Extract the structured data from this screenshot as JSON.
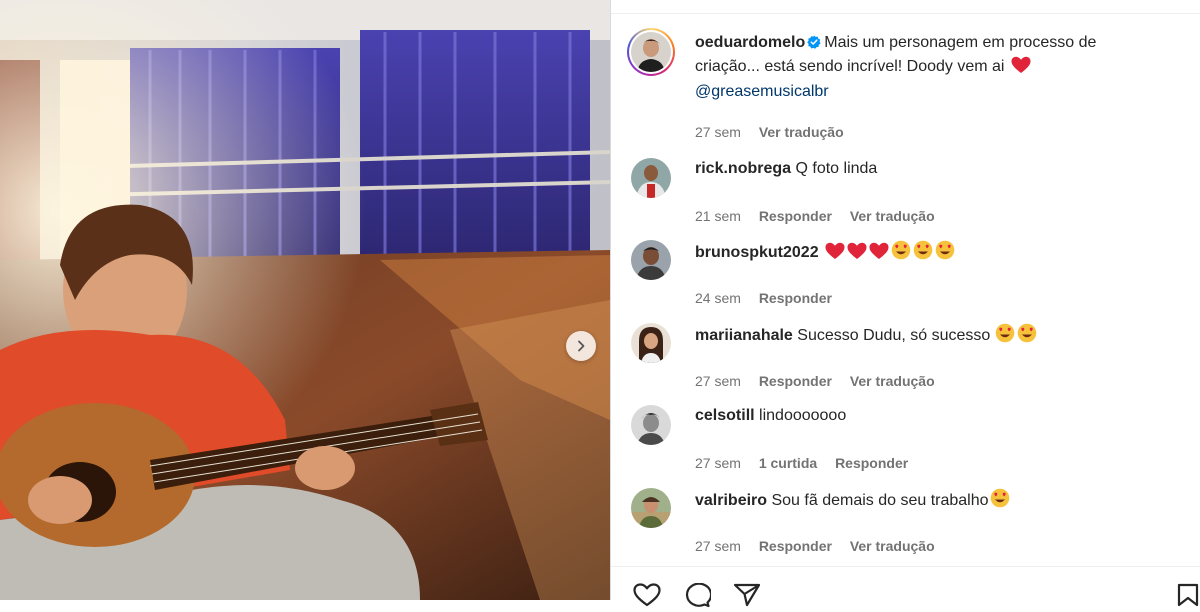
{
  "post": {
    "author": "oeduardomelo",
    "caption_line1": "Mais um personagem em processo de",
    "caption_line2": "criação... está sendo incrível! Doody vem ai",
    "mention": "@greasemusicalbr",
    "time": "27 sem",
    "translate": "Ver tradução",
    "verified": true,
    "caption_emoji": "red-heart"
  },
  "comments": [
    {
      "user": "rick.nobrega",
      "text": "Q foto linda",
      "time": "21 sem",
      "likes": "",
      "reply": "Responder",
      "translate": "Ver tradução",
      "emojis": []
    },
    {
      "user": "brunospkut2022",
      "text": "",
      "time": "24 sem",
      "likes": "",
      "reply": "Responder",
      "translate": "",
      "emojis": [
        "red-heart",
        "red-heart",
        "red-heart",
        "heart-eyes",
        "heart-eyes",
        "heart-eyes"
      ]
    },
    {
      "user": "mariianahale",
      "text": "Sucesso Dudu, só sucesso",
      "time": "27 sem",
      "likes": "",
      "reply": "Responder",
      "translate": "Ver tradução",
      "emojis": [
        "heart-eyes",
        "heart-eyes"
      ]
    },
    {
      "user": "celsotill",
      "text": "lindooooooo",
      "time": "27 sem",
      "likes": "1 curtida",
      "reply": "Responder",
      "translate": "",
      "emojis": []
    },
    {
      "user": "valribeiro",
      "text": "Sou fã demais do seu trabalho",
      "time": "27 sem",
      "likes": "",
      "reply": "Responder",
      "translate": "Ver tradução",
      "emojis": [
        "heart-eyes"
      ]
    }
  ],
  "actions": {
    "icons": [
      "heart-outline-icon",
      "comment-icon",
      "share-icon",
      "save-icon"
    ]
  },
  "colors": {
    "text": "#262626",
    "meta": "#737373",
    "mention": "#00376b",
    "verified": "#0095f6",
    "heart": "#e0245e"
  }
}
